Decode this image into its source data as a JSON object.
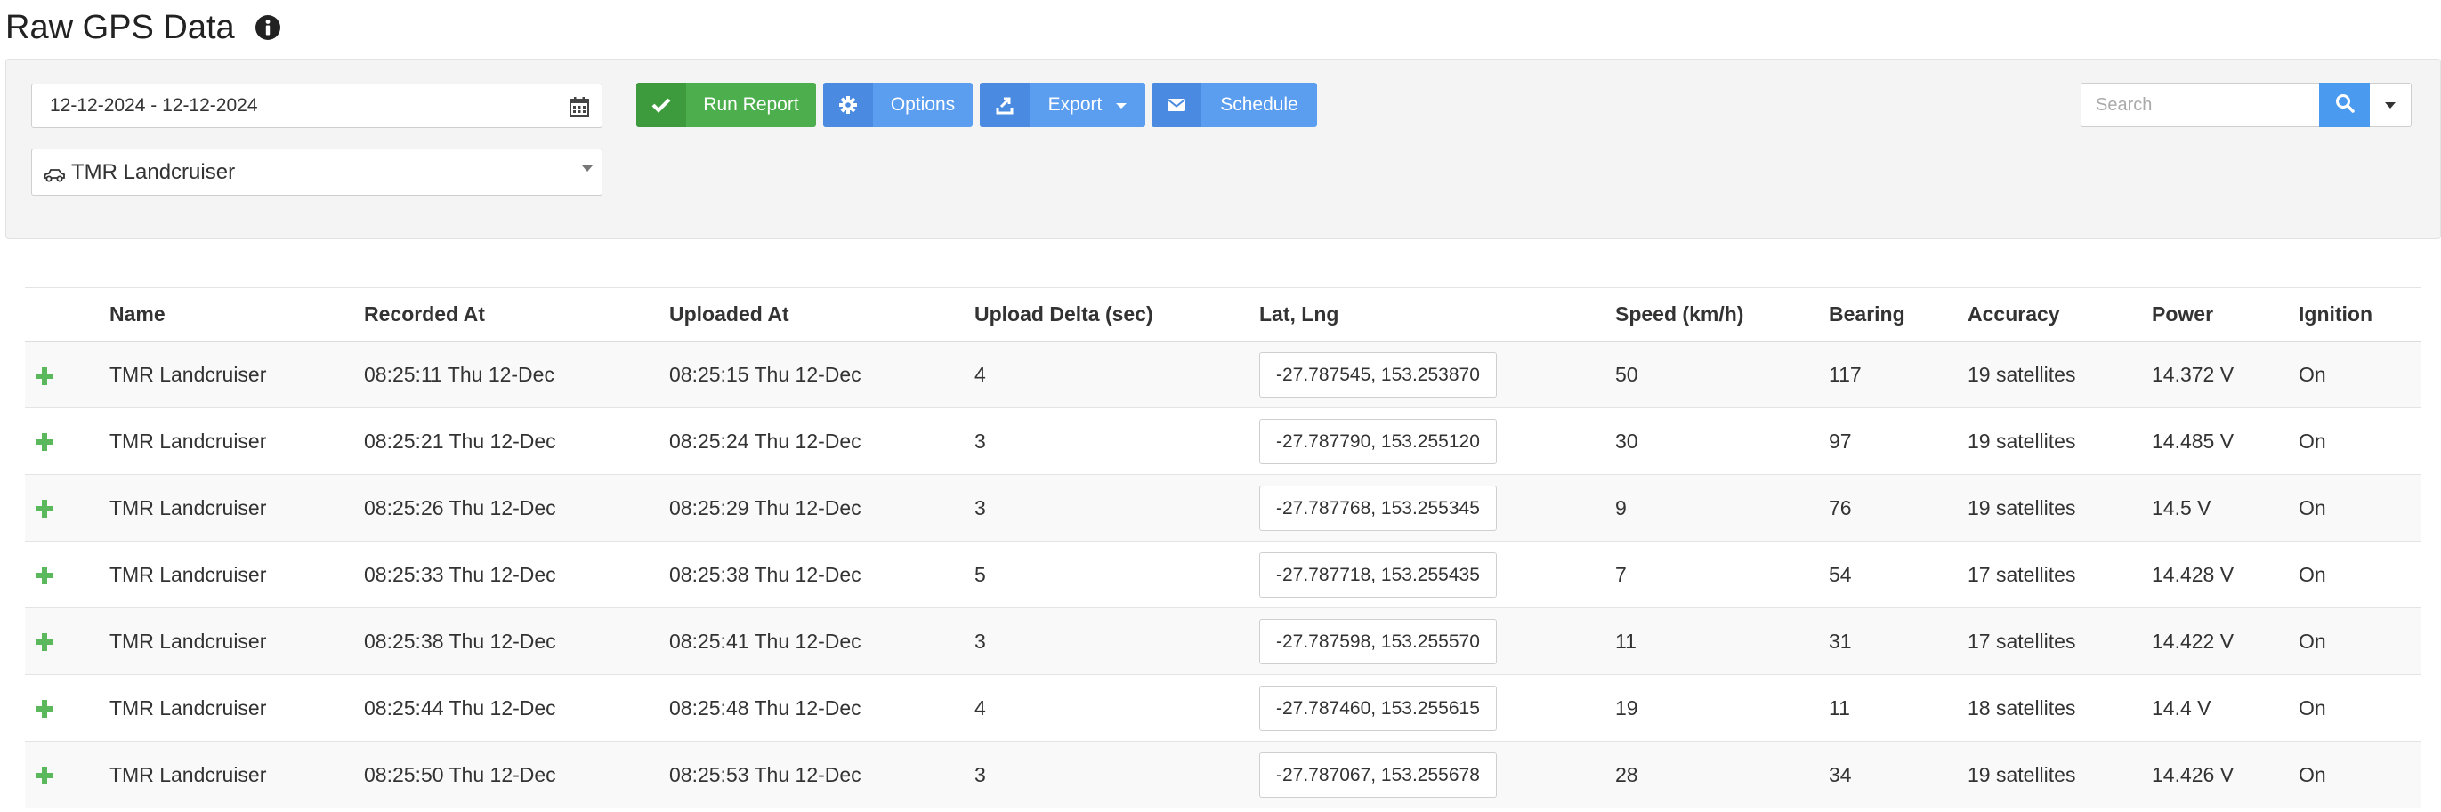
{
  "header": {
    "title": "Raw GPS Data",
    "info_icon": "info-circle-icon"
  },
  "filters": {
    "date_range": "12-12-2024 - 12-12-2024",
    "calendar_icon": "calendar-icon",
    "vehicle": "TMR Landcruiser",
    "vehicle_icon": "car-icon"
  },
  "toolbar": {
    "run_label": "Run Report",
    "run_icon": "check-icon",
    "options_label": "Options",
    "options_icon": "gear-icon",
    "export_label": "Export",
    "export_icon": "export-icon",
    "schedule_label": "Schedule",
    "schedule_icon": "envelope-icon"
  },
  "search": {
    "placeholder": "Search",
    "value": "",
    "icon": "search-icon"
  },
  "colors": {
    "run_button": "#4cae4c",
    "primary_button": "#5b9ef0",
    "search_button": "#4a9af0",
    "expand_plus": "#5cb85c"
  },
  "table": {
    "columns": [
      "",
      "Name",
      "Recorded At",
      "Uploaded At",
      "Upload Delta (sec)",
      "Lat, Lng",
      "Speed (km/h)",
      "Bearing",
      "Accuracy",
      "Power",
      "Ignition"
    ],
    "rows": [
      {
        "name": "TMR Landcruiser",
        "recorded_at": "08:25:11 Thu 12-Dec",
        "uploaded_at": "08:25:15 Thu 12-Dec",
        "upload_delta": "4",
        "latlng": "-27.787545, 153.253870",
        "speed": "50",
        "bearing": "117",
        "accuracy": "19 satellites",
        "power": "14.372 V",
        "ignition": "On"
      },
      {
        "name": "TMR Landcruiser",
        "recorded_at": "08:25:21 Thu 12-Dec",
        "uploaded_at": "08:25:24 Thu 12-Dec",
        "upload_delta": "3",
        "latlng": "-27.787790, 153.255120",
        "speed": "30",
        "bearing": "97",
        "accuracy": "19 satellites",
        "power": "14.485 V",
        "ignition": "On"
      },
      {
        "name": "TMR Landcruiser",
        "recorded_at": "08:25:26 Thu 12-Dec",
        "uploaded_at": "08:25:29 Thu 12-Dec",
        "upload_delta": "3",
        "latlng": "-27.787768, 153.255345",
        "speed": "9",
        "bearing": "76",
        "accuracy": "19 satellites",
        "power": "14.5 V",
        "ignition": "On"
      },
      {
        "name": "TMR Landcruiser",
        "recorded_at": "08:25:33 Thu 12-Dec",
        "uploaded_at": "08:25:38 Thu 12-Dec",
        "upload_delta": "5",
        "latlng": "-27.787718, 153.255435",
        "speed": "7",
        "bearing": "54",
        "accuracy": "17 satellites",
        "power": "14.428 V",
        "ignition": "On"
      },
      {
        "name": "TMR Landcruiser",
        "recorded_at": "08:25:38 Thu 12-Dec",
        "uploaded_at": "08:25:41 Thu 12-Dec",
        "upload_delta": "3",
        "latlng": "-27.787598, 153.255570",
        "speed": "11",
        "bearing": "31",
        "accuracy": "17 satellites",
        "power": "14.422 V",
        "ignition": "On"
      },
      {
        "name": "TMR Landcruiser",
        "recorded_at": "08:25:44 Thu 12-Dec",
        "uploaded_at": "08:25:48 Thu 12-Dec",
        "upload_delta": "4",
        "latlng": "-27.787460, 153.255615",
        "speed": "19",
        "bearing": "11",
        "accuracy": "18 satellites",
        "power": "14.4 V",
        "ignition": "On"
      },
      {
        "name": "TMR Landcruiser",
        "recorded_at": "08:25:50 Thu 12-Dec",
        "uploaded_at": "08:25:53 Thu 12-Dec",
        "upload_delta": "3",
        "latlng": "-27.787067, 153.255678",
        "speed": "28",
        "bearing": "34",
        "accuracy": "19 satellites",
        "power": "14.426 V",
        "ignition": "On"
      }
    ]
  }
}
